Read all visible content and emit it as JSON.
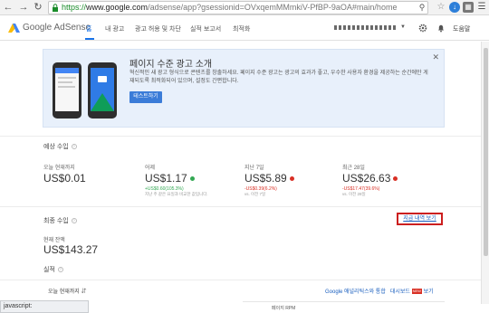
{
  "browser": {
    "url_scheme": "https://",
    "url_host": "www.google.com",
    "url_path": "/adsense/app?gsessionid=OVxqemMMmkiV-PfBP-9aOA#main/home",
    "status_text": "javascript:"
  },
  "header": {
    "logo_text": "Google AdSense",
    "tabs": [
      "홈",
      "내 광고",
      "광고 허용 및 차단",
      "실적 보고서",
      "최적화"
    ],
    "help_label": "도움말"
  },
  "promo": {
    "title": "페이지 수준 광고 소개",
    "description": "혁신적인 새 광고 형식으로 콘텐츠를 창출하세요. 페이지 수준 광고는 광고의 효과가 좋고, 우수한 사용자 환경을 제공하는 순간에만 게재되도록 최적화되어 있으며, 설정도 간편합니다.",
    "button_label": "테스트하기"
  },
  "estimated": {
    "title": "예상 수입",
    "metrics": [
      {
        "label": "오늘 현재까지",
        "value": "US$0.01",
        "sub": "",
        "sub2": "",
        "dot": ""
      },
      {
        "label": "어제",
        "value": "US$1.17",
        "sub": "+US$0.60(105.3%)",
        "sub2": "지난 주 같은 요일과 비교한 값입니다.",
        "dot": "#33a853"
      },
      {
        "label": "지난 7일",
        "value": "US$5.89",
        "sub": "-US$0.39(6.2%)",
        "sub2": "vs. 이전 7일",
        "dot": "#d93025"
      },
      {
        "label": "최근 28일",
        "value": "US$26.63",
        "sub": "-US$17.47(39.6%)",
        "sub2": "vs. 이전 28일",
        "dot": "#d93025"
      }
    ]
  },
  "final": {
    "title": "최종 수입",
    "history_link": "지급 내역 보기",
    "balance_label": "현재 잔액",
    "balance_value": "US$143.27"
  },
  "performance": {
    "title": "실적",
    "period": "오늘 현재까지",
    "analytics_link": "Google 애널리틱스와 통합",
    "dashboard_link": "대시보드",
    "new_badge": "NEW",
    "view_link": "보기",
    "panel_heading": "페이지 RPM"
  }
}
